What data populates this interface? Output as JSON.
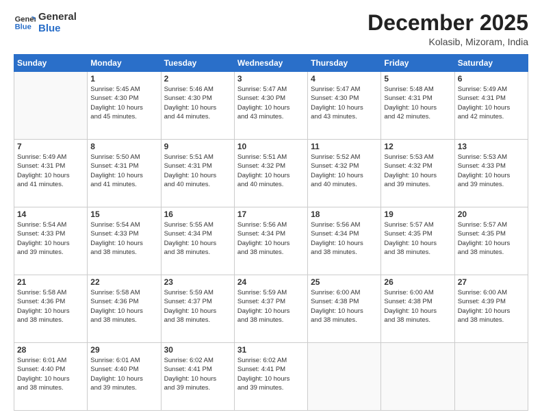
{
  "logo": {
    "line1": "General",
    "line2": "Blue"
  },
  "title": "December 2025",
  "subtitle": "Kolasib, Mizoram, India",
  "days_header": [
    "Sunday",
    "Monday",
    "Tuesday",
    "Wednesday",
    "Thursday",
    "Friday",
    "Saturday"
  ],
  "weeks": [
    [
      {
        "day": "",
        "info": ""
      },
      {
        "day": "1",
        "info": "Sunrise: 5:45 AM\nSunset: 4:30 PM\nDaylight: 10 hours\nand 45 minutes."
      },
      {
        "day": "2",
        "info": "Sunrise: 5:46 AM\nSunset: 4:30 PM\nDaylight: 10 hours\nand 44 minutes."
      },
      {
        "day": "3",
        "info": "Sunrise: 5:47 AM\nSunset: 4:30 PM\nDaylight: 10 hours\nand 43 minutes."
      },
      {
        "day": "4",
        "info": "Sunrise: 5:47 AM\nSunset: 4:30 PM\nDaylight: 10 hours\nand 43 minutes."
      },
      {
        "day": "5",
        "info": "Sunrise: 5:48 AM\nSunset: 4:31 PM\nDaylight: 10 hours\nand 42 minutes."
      },
      {
        "day": "6",
        "info": "Sunrise: 5:49 AM\nSunset: 4:31 PM\nDaylight: 10 hours\nand 42 minutes."
      }
    ],
    [
      {
        "day": "7",
        "info": "Sunrise: 5:49 AM\nSunset: 4:31 PM\nDaylight: 10 hours\nand 41 minutes."
      },
      {
        "day": "8",
        "info": "Sunrise: 5:50 AM\nSunset: 4:31 PM\nDaylight: 10 hours\nand 41 minutes."
      },
      {
        "day": "9",
        "info": "Sunrise: 5:51 AM\nSunset: 4:31 PM\nDaylight: 10 hours\nand 40 minutes."
      },
      {
        "day": "10",
        "info": "Sunrise: 5:51 AM\nSunset: 4:32 PM\nDaylight: 10 hours\nand 40 minutes."
      },
      {
        "day": "11",
        "info": "Sunrise: 5:52 AM\nSunset: 4:32 PM\nDaylight: 10 hours\nand 40 minutes."
      },
      {
        "day": "12",
        "info": "Sunrise: 5:53 AM\nSunset: 4:32 PM\nDaylight: 10 hours\nand 39 minutes."
      },
      {
        "day": "13",
        "info": "Sunrise: 5:53 AM\nSunset: 4:33 PM\nDaylight: 10 hours\nand 39 minutes."
      }
    ],
    [
      {
        "day": "14",
        "info": "Sunrise: 5:54 AM\nSunset: 4:33 PM\nDaylight: 10 hours\nand 39 minutes."
      },
      {
        "day": "15",
        "info": "Sunrise: 5:54 AM\nSunset: 4:33 PM\nDaylight: 10 hours\nand 38 minutes."
      },
      {
        "day": "16",
        "info": "Sunrise: 5:55 AM\nSunset: 4:34 PM\nDaylight: 10 hours\nand 38 minutes."
      },
      {
        "day": "17",
        "info": "Sunrise: 5:56 AM\nSunset: 4:34 PM\nDaylight: 10 hours\nand 38 minutes."
      },
      {
        "day": "18",
        "info": "Sunrise: 5:56 AM\nSunset: 4:34 PM\nDaylight: 10 hours\nand 38 minutes."
      },
      {
        "day": "19",
        "info": "Sunrise: 5:57 AM\nSunset: 4:35 PM\nDaylight: 10 hours\nand 38 minutes."
      },
      {
        "day": "20",
        "info": "Sunrise: 5:57 AM\nSunset: 4:35 PM\nDaylight: 10 hours\nand 38 minutes."
      }
    ],
    [
      {
        "day": "21",
        "info": "Sunrise: 5:58 AM\nSunset: 4:36 PM\nDaylight: 10 hours\nand 38 minutes."
      },
      {
        "day": "22",
        "info": "Sunrise: 5:58 AM\nSunset: 4:36 PM\nDaylight: 10 hours\nand 38 minutes."
      },
      {
        "day": "23",
        "info": "Sunrise: 5:59 AM\nSunset: 4:37 PM\nDaylight: 10 hours\nand 38 minutes."
      },
      {
        "day": "24",
        "info": "Sunrise: 5:59 AM\nSunset: 4:37 PM\nDaylight: 10 hours\nand 38 minutes."
      },
      {
        "day": "25",
        "info": "Sunrise: 6:00 AM\nSunset: 4:38 PM\nDaylight: 10 hours\nand 38 minutes."
      },
      {
        "day": "26",
        "info": "Sunrise: 6:00 AM\nSunset: 4:38 PM\nDaylight: 10 hours\nand 38 minutes."
      },
      {
        "day": "27",
        "info": "Sunrise: 6:00 AM\nSunset: 4:39 PM\nDaylight: 10 hours\nand 38 minutes."
      }
    ],
    [
      {
        "day": "28",
        "info": "Sunrise: 6:01 AM\nSunset: 4:40 PM\nDaylight: 10 hours\nand 38 minutes."
      },
      {
        "day": "29",
        "info": "Sunrise: 6:01 AM\nSunset: 4:40 PM\nDaylight: 10 hours\nand 39 minutes."
      },
      {
        "day": "30",
        "info": "Sunrise: 6:02 AM\nSunset: 4:41 PM\nDaylight: 10 hours\nand 39 minutes."
      },
      {
        "day": "31",
        "info": "Sunrise: 6:02 AM\nSunset: 4:41 PM\nDaylight: 10 hours\nand 39 minutes."
      },
      {
        "day": "",
        "info": ""
      },
      {
        "day": "",
        "info": ""
      },
      {
        "day": "",
        "info": ""
      }
    ]
  ]
}
